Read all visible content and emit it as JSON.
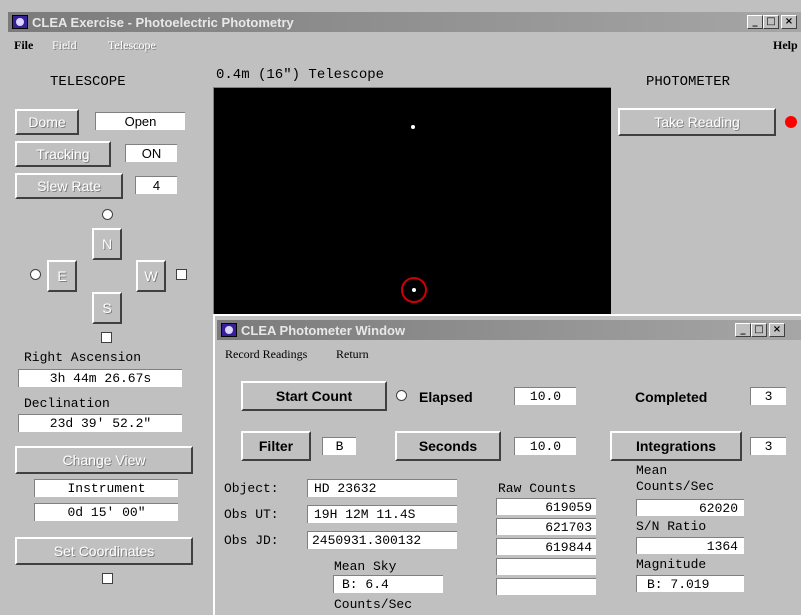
{
  "main_window": {
    "title": "CLEA Exercise - Photoelectric Photometry",
    "menu": [
      "File",
      "Field",
      "Telescope"
    ],
    "help": "Help"
  },
  "telescope": {
    "heading": "TELESCOPE",
    "dome_label": "Dome",
    "dome_value": "Open",
    "tracking_label": "Tracking",
    "tracking_value": "ON",
    "slew_label": "Slew Rate",
    "slew_value": "4",
    "n": "N",
    "e": "E",
    "w": "W",
    "s": "S",
    "ra_label": "Right Ascension",
    "ra_value": "3h 44m 26.67s",
    "dec_label": "Declination",
    "dec_value": "23d 39' 52.2\"",
    "change_view": "Change View",
    "instrument": "Instrument",
    "field_size": "0d 15' 00\"",
    "set_coordinates": "Set Coordinates"
  },
  "view": {
    "title": "0.4m (16\") Telescope"
  },
  "photometer": {
    "heading": "PHOTOMETER",
    "take_reading": "Take Reading",
    "indicator_color": "#ff0000"
  },
  "photometer_window": {
    "title": "CLEA Photometer Window",
    "menu": [
      "Record Readings",
      "Return"
    ],
    "start_count": "Start Count",
    "elapsed_label": "Elapsed",
    "elapsed_value": "10.0",
    "completed_label": "Completed",
    "completed_value": "3",
    "filter_label": "Filter",
    "filter_value": "B",
    "seconds_label": "Seconds",
    "seconds_value": "10.0",
    "integrations_label": "Integrations",
    "integrations_value": "3",
    "object_label": "Object:",
    "object_value": "HD 23632",
    "obs_ut_label": "Obs UT:",
    "obs_ut_value": "19H 12M 11.4S",
    "obs_jd_label": "Obs JD:",
    "obs_jd_value": "2450931.300132",
    "raw_counts_label": "Raw Counts",
    "raw_counts": [
      "619059",
      "621703",
      "619844",
      "",
      ""
    ],
    "mean_counts_label_1": "Mean",
    "mean_counts_label_2": "Counts/Sec",
    "mean_counts_value": "62020",
    "sn_label": "S/N Ratio",
    "sn_value": "1364",
    "mag_label": "Magnitude",
    "mag_value": "B: 7.019",
    "mean_sky_label": "Mean Sky",
    "mean_sky_value": "B: 6.4",
    "sky_unit": "Counts/Sec"
  }
}
